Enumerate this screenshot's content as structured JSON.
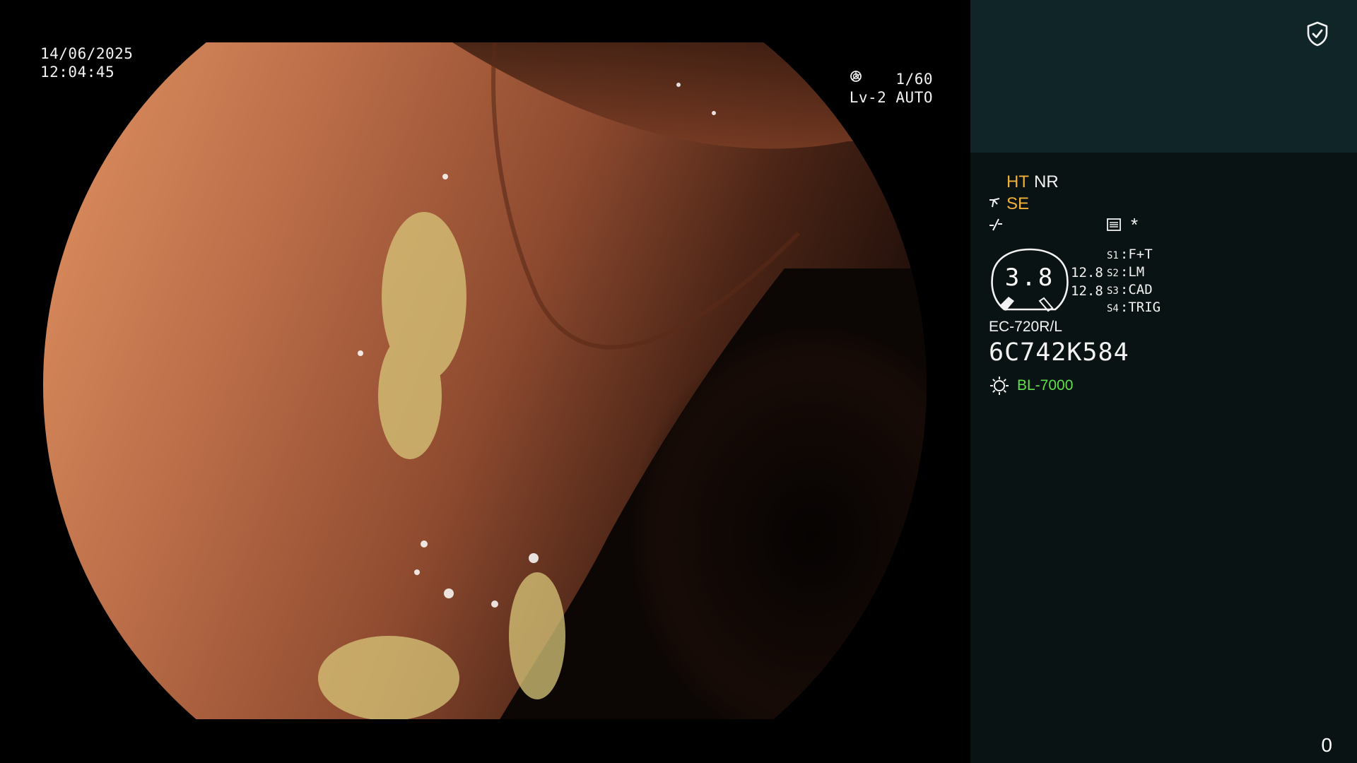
{
  "overlay": {
    "date": "14/06/2025",
    "time": "12:04:45",
    "shutter": "1/60",
    "iris": "Lv-2 AUTO"
  },
  "panel": {
    "ht_label": "HT",
    "nr_label": "NR",
    "se_label": "SE",
    "asterisk": "*",
    "gauge_value": "3.8",
    "value_top": "12.8",
    "value_bottom": "12.8",
    "switches": [
      {
        "key": "S1",
        "value": "F+T"
      },
      {
        "key": "S2",
        "value": "LM"
      },
      {
        "key": "S3",
        "value": "CAD"
      },
      {
        "key": "S4",
        "value": "TRIG"
      }
    ],
    "scope_model": "EC-720R/L",
    "serial": "6C742K584",
    "light_source": "BL-7000",
    "counter": "0"
  },
  "colors": {
    "panel_bg": "#0a1313",
    "panel_header_bg": "#0f2527",
    "amber": "#f0b03a",
    "green": "#5fe04a"
  },
  "icons": [
    "shutter-icon",
    "iris-icon",
    "shield-check-icon",
    "scissor-icon",
    "wave-icon",
    "list-icon",
    "sun-icon"
  ]
}
